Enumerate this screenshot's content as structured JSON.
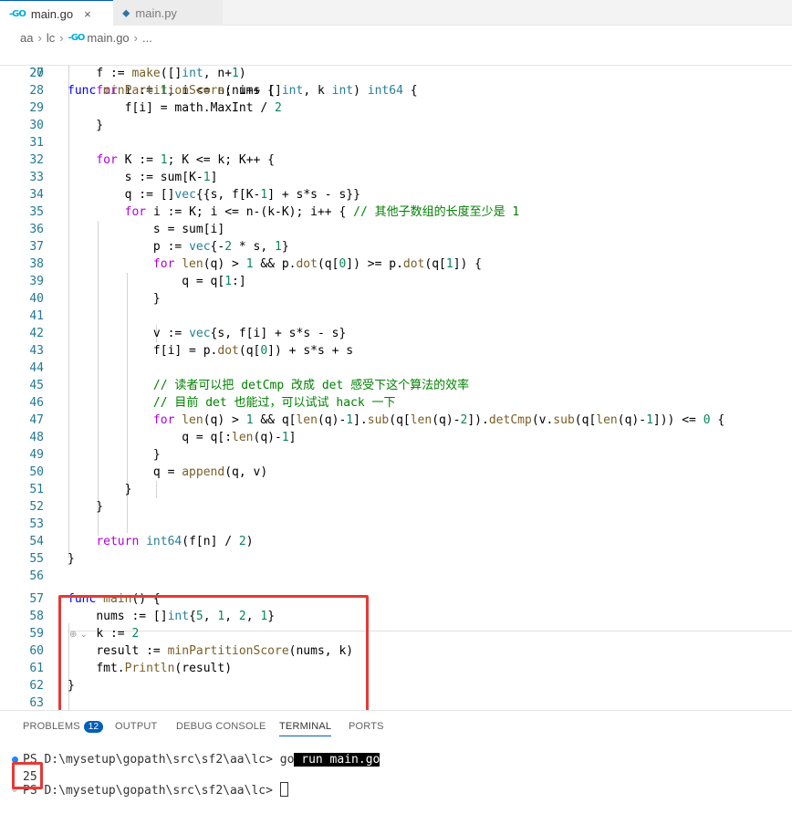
{
  "tabs": [
    {
      "label": "main.go",
      "icon": "go-file-icon",
      "active": true,
      "close": "×"
    },
    {
      "label": "main.py",
      "icon": "python-file-icon",
      "active": false
    }
  ],
  "breadcrumb": [
    "aa",
    "lc",
    "main.go",
    "..."
  ],
  "icons": {
    "go": "-GO",
    "py": "⬥"
  },
  "editor": {
    "sticky": {
      "num": "20",
      "text": "func minPartitionScore(nums []int, k int) int64 {"
    },
    "lines": [
      {
        "num": "27",
        "text": "    f := make([]int, n+1)"
      },
      {
        "num": "28",
        "text": "    for i := 1; i <= n; i++ {"
      },
      {
        "num": "29",
        "text": "        f[i] = math.MaxInt / 2"
      },
      {
        "num": "30",
        "text": "    }"
      },
      {
        "num": "31",
        "text": ""
      },
      {
        "num": "32",
        "text": "    for K := 1; K <= k; K++ {"
      },
      {
        "num": "33",
        "text": "        s := sum[K-1]"
      },
      {
        "num": "34",
        "text": "        q := []vec{{s, f[K-1] + s*s - s}}"
      },
      {
        "num": "35",
        "text": "        for i := K; i <= n-(k-K); i++ { // 其他子数组的长度至少是 1"
      },
      {
        "num": "36",
        "text": "            s = sum[i]"
      },
      {
        "num": "37",
        "text": "            p := vec{-2 * s, 1}"
      },
      {
        "num": "38",
        "text": "            for len(q) > 1 && p.dot(q[0]) >= p.dot(q[1]) {"
      },
      {
        "num": "39",
        "text": "                q = q[1:]"
      },
      {
        "num": "40",
        "text": "            }"
      },
      {
        "num": "41",
        "text": ""
      },
      {
        "num": "42",
        "text": "            v := vec{s, f[i] + s*s - s}"
      },
      {
        "num": "43",
        "text": "            f[i] = p.dot(q[0]) + s*s + s"
      },
      {
        "num": "44",
        "text": ""
      },
      {
        "num": "45",
        "text": "            // 读者可以把 detCmp 改成 det 感受下这个算法的效率"
      },
      {
        "num": "46",
        "text": "            // 目前 det 也能过，可以试试 hack 一下"
      },
      {
        "num": "47",
        "text": "            for len(q) > 1 && q[len(q)-1].sub(q[len(q)-2]).detCmp(v.sub(q[len(q)-1])) <= 0 {"
      },
      {
        "num": "48",
        "text": "                q = q[:len(q)-1]"
      },
      {
        "num": "49",
        "text": "            }"
      },
      {
        "num": "50",
        "text": "            q = append(q, v)"
      },
      {
        "num": "51",
        "text": "        }"
      },
      {
        "num": "52",
        "text": "    }"
      },
      {
        "num": "53",
        "text": ""
      },
      {
        "num": "54",
        "text": "    return int64(f[n] / 2)"
      },
      {
        "num": "55",
        "text": "}"
      },
      {
        "num": "56",
        "text": ""
      },
      {
        "num": "57",
        "text": "func main() {"
      },
      {
        "num": "58",
        "text": "    nums := []int{5, 1, 2, 1}"
      },
      {
        "num": "59",
        "text": "    k := 2"
      },
      {
        "num": "60",
        "text": "    result := minPartitionScore(nums, k)"
      },
      {
        "num": "61",
        "text": "    fmt.Println(result)"
      },
      {
        "num": "62",
        "text": "}"
      },
      {
        "num": "63",
        "text": ""
      }
    ]
  },
  "panel": {
    "tabs": [
      "PROBLEMS",
      "OUTPUT",
      "DEBUG CONSOLE",
      "TERMINAL",
      "PORTS"
    ],
    "problems_count": "12",
    "active_tab": "TERMINAL"
  },
  "terminal": {
    "prompt1": "PS D:\\mysetup\\gopath\\src\\sf2\\aa\\lc> ",
    "cmd_go": "go",
    "cmd_rest": " run main.go",
    "output": "25",
    "prompt2": "PS D:\\mysetup\\gopath\\src\\sf2\\aa\\lc> "
  },
  "colors": {
    "keyword": "#0000ff",
    "control": "#af00db",
    "function": "#795e26",
    "type": "#267f99",
    "number": "#098658",
    "comment": "#008000",
    "line_number": "#237893",
    "highlight": "#e53935",
    "accent": "#005fb8"
  }
}
